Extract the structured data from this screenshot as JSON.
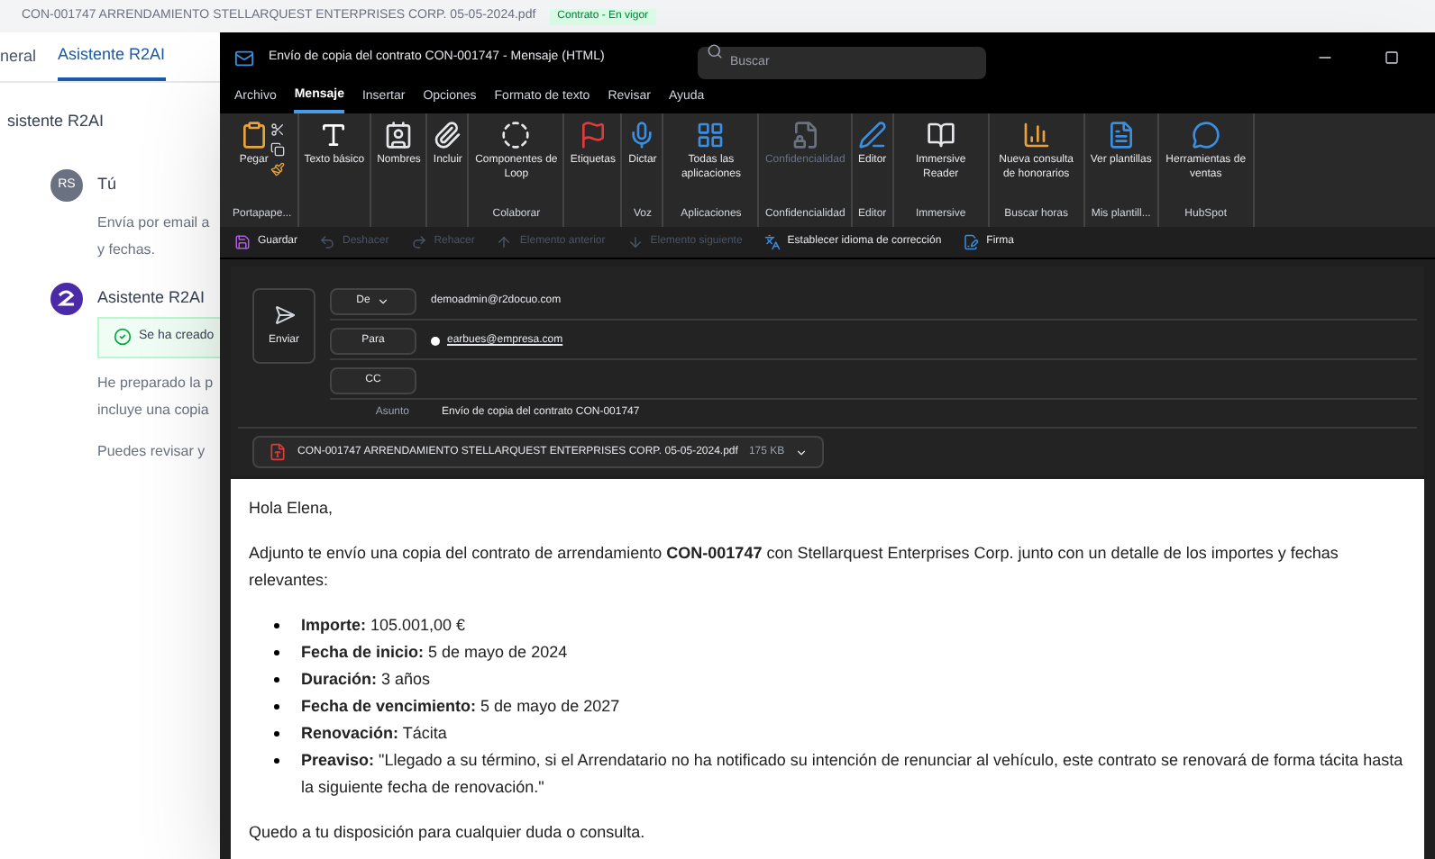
{
  "background": {
    "header_text": "CON-001747 ARRENDAMIENTO STELLARQUEST ENTERPRISES CORP. 05-05-2024.pdf",
    "badge": "Contrato - En vigor",
    "tabs": [
      {
        "label": "neral",
        "selected": false
      },
      {
        "label": "Asistente R2AI",
        "selected": true
      }
    ],
    "panel_title": "sistente R2AI",
    "messages": [
      {
        "kind": "user",
        "avatar": "RS",
        "author": "Tú",
        "lines": [
          "Envía por email a",
          "y fechas."
        ]
      },
      {
        "kind": "bot",
        "author": "Asistente R2AI",
        "notice": "Se ha creado",
        "lines": [
          "He preparado la p",
          "incluye una copia",
          "Puedes revisar y"
        ]
      }
    ]
  },
  "window": {
    "title": "Envío de copia del contrato CON-001747  -  Mensaje (HTML)",
    "search": {
      "placeholder": "Buscar"
    },
    "menu_tabs": [
      {
        "label": "Archivo",
        "selected": false
      },
      {
        "label": "Mensaje",
        "selected": true
      },
      {
        "label": "Insertar",
        "selected": false
      },
      {
        "label": "Opciones",
        "selected": false
      },
      {
        "label": "Formato de texto",
        "selected": false
      },
      {
        "label": "Revisar",
        "selected": false
      },
      {
        "label": "Ayuda",
        "selected": false
      }
    ],
    "ribbon": [
      {
        "label": "Portapape...",
        "buttons": [
          {
            "label": "Pegar",
            "disabled": false
          }
        ]
      },
      {
        "buttons": [
          {
            "label": "Texto básico",
            "disabled": false
          }
        ]
      },
      {
        "buttons": [
          {
            "label": "Nombres",
            "disabled": false
          }
        ]
      },
      {
        "buttons": [
          {
            "label": "Incluir",
            "disabled": false
          }
        ]
      },
      {
        "label": "Colaborar",
        "buttons": [
          {
            "label": "Componentes de Loop",
            "disabled": false
          }
        ]
      },
      {
        "buttons": [
          {
            "label": "Etiquetas",
            "disabled": false
          }
        ]
      },
      {
        "label": "Voz",
        "buttons": [
          {
            "label": "Dictar",
            "disabled": false
          }
        ]
      },
      {
        "label": "Aplicaciones",
        "buttons": [
          {
            "label": "Todas las aplicaciones",
            "disabled": false
          }
        ]
      },
      {
        "label": "Confidencialidad",
        "buttons": [
          {
            "label": "Confidencialidad",
            "disabled": true
          }
        ]
      },
      {
        "label": "Editor",
        "buttons": [
          {
            "label": "Editor",
            "disabled": false
          }
        ]
      },
      {
        "label": "Immersive",
        "buttons": [
          {
            "label": "Immersive Reader",
            "disabled": false
          }
        ]
      },
      {
        "label": "Buscar horas",
        "buttons": [
          {
            "label": "Nueva consulta de honorarios",
            "disabled": false
          }
        ]
      },
      {
        "label": "Mis plantill...",
        "buttons": [
          {
            "label": "Ver plantillas",
            "disabled": false
          }
        ]
      },
      {
        "label": "HubSpot",
        "buttons": [
          {
            "label": "Herramientas de ventas",
            "disabled": false
          }
        ]
      }
    ],
    "quick_access": [
      {
        "label": "Guardar",
        "disabled": false
      },
      {
        "label": "Deshacer",
        "disabled": true
      },
      {
        "label": "Rehacer",
        "disabled": true
      },
      {
        "label": "Elemento anterior",
        "disabled": true
      },
      {
        "label": "Elemento siguiente",
        "disabled": true
      },
      {
        "label": "Establecer idioma de corrección",
        "disabled": false
      },
      {
        "label": "Firma",
        "disabled": false
      }
    ],
    "compose": {
      "send": "Enviar",
      "from_label": "De",
      "from": "demoadmin@r2docuo.com",
      "to_label": "Para",
      "to": "earbues@empresa.com",
      "cc_label": "CC",
      "subject_label": "Asunto",
      "subject": "Envío de copia del contrato CON-001747",
      "attachment": {
        "name": "CON-001747 ARRENDAMIENTO STELLARQUEST ENTERPRISES CORP. 05-05-2024.pdf",
        "size": "175 KB"
      }
    },
    "body": {
      "greeting": "Hola Elena,",
      "intro": "Adjunto te envío una copia del contrato de arrendamiento **CON-001747** con Stellarquest Enterprises Corp. junto con un detalle de los importes y fechas relevantes:",
      "items": [
        {
          "term": "Importe:",
          "value": "105.001,00 €"
        },
        {
          "term": "Fecha de inicio:",
          "value": "5 de mayo de 2024"
        },
        {
          "term": "Duración:",
          "value": "3 años"
        },
        {
          "term": "Fecha de vencimiento:",
          "value": "5 de mayo de 2027"
        },
        {
          "term": "Renovación:",
          "value": "Tácita"
        },
        {
          "term": "Preaviso:",
          "value": "\"Llegado a su término, si el Arrendatario no ha notificado su intención de renunciar al vehículo, este contrato se renovará de forma tácita hasta la siguiente fecha de renovación.\""
        }
      ],
      "closing": "Quedo a tu disposición para cualquier duda o consulta."
    }
  }
}
